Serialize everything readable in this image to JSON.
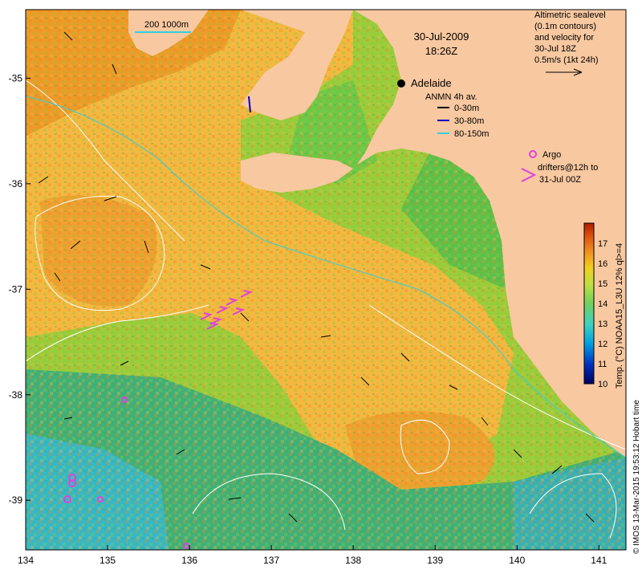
{
  "map": {
    "date": "30-Jul-2009",
    "time": "18:26Z",
    "city": "Adelaide",
    "x_ticks": [
      "134",
      "135",
      "136",
      "137",
      "138",
      "139",
      "140",
      "141"
    ],
    "y_ticks": [
      "-35",
      "-36",
      "-37",
      "-38",
      "-39"
    ],
    "scale_label": "200  1000m",
    "colors": {
      "land": "#f8c8a0",
      "sst_warm": "#f2a030",
      "sst_mid": "#a0d040",
      "sst_cool": "#30b0d0",
      "contour": "#ffffff",
      "argo": "#e040e0",
      "current_0_30": "#000000",
      "current_30_80": "#0000c0",
      "current_80_150": "#30d0e0"
    }
  },
  "legend_top": {
    "line1": "Altimetric sealevel",
    "line2": "(0.1m contours)",
    "line3": "and velocity for",
    "line4": "30-Jul 18Z",
    "line5": "0.5m/s (1kt 24h)"
  },
  "anmn": {
    "title": "ANMN 4h av.",
    "items": [
      "0-30m",
      "30-80m",
      "80-150m"
    ]
  },
  "argo": {
    "label": "Argo",
    "drifters_line1": "drifters@12h to",
    "drifters_line2": "31-Jul 00Z"
  },
  "colorbar": {
    "label": "Temp. (°C) NOAA15_L3U 12% ql>=4",
    "ticks": [
      "10",
      "11",
      "12",
      "13",
      "14",
      "15",
      "16",
      "17"
    ],
    "range": [
      10,
      18
    ],
    "colors": [
      "#000060",
      "#0030c0",
      "#00a0e0",
      "#40d0c0",
      "#70d060",
      "#c0e040",
      "#f0d020",
      "#f09020",
      "#e05010",
      "#b02000"
    ]
  },
  "credit": "© IMOS 13-Mar-2015 19:53:12 Hobart time"
}
